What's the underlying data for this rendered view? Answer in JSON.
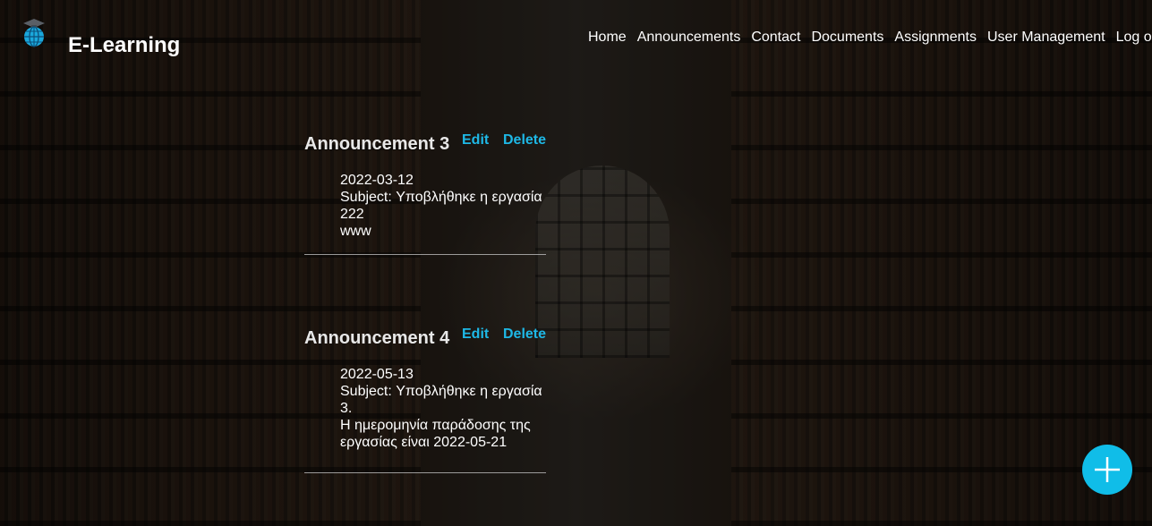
{
  "brand": {
    "title": "E-Learning",
    "icon": "globe-graduation-cap-icon"
  },
  "nav": {
    "items": [
      "Home",
      "Announcements",
      "Contact",
      "Documents",
      "Assignments",
      "User Management",
      "Log out"
    ]
  },
  "announcements": [
    {
      "title": "Announcement 3",
      "edit_label": "Edit",
      "delete_label": "Delete",
      "date": "2022-03-12",
      "subject": "Subject: Υποβλήθηκε η εργασία 222",
      "text": "www"
    },
    {
      "title": "Announcement 4",
      "edit_label": "Edit",
      "delete_label": "Delete",
      "date": "2022-05-13",
      "subject": "Subject: Υποβλήθηκε η εργασία 3.",
      "text": "Η ημερομηνία παράδοσης της εργασίας είναι 2022-05-21"
    }
  ],
  "fab": {
    "icon": "plus-icon"
  },
  "colors": {
    "accent": "#1eb8e6",
    "fab": "#10bde8"
  }
}
